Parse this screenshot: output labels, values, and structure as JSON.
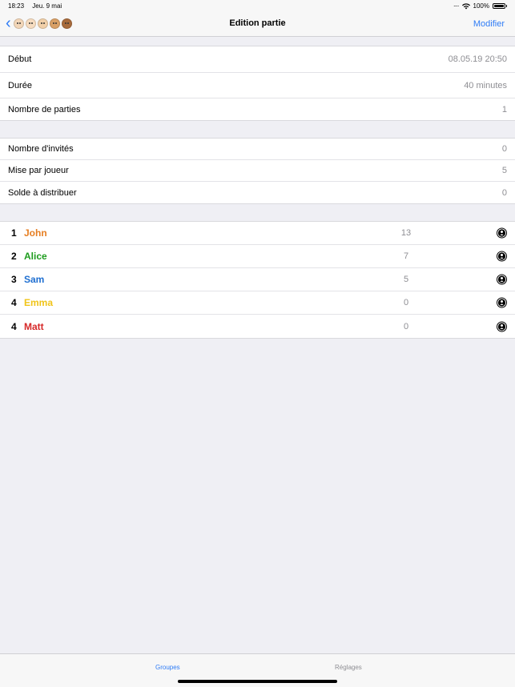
{
  "status_bar": {
    "time": "18:23",
    "date": "Jeu. 9 mai",
    "battery": "100%"
  },
  "nav": {
    "title": "Edition partie",
    "modify_label": "Modifier",
    "avatars": [
      "#f2d6b8",
      "#f6dcc0",
      "#f0cfa8",
      "#d9a066",
      "#a86b3c"
    ]
  },
  "game_info": {
    "start_label": "Début",
    "start_value": "08.05.19 20:50",
    "duration_label": "Durée",
    "duration_value": "40 minutes",
    "count_label": "Nombre de parties",
    "count_value": "1"
  },
  "stakes": {
    "guests_label": "Nombre d'invités",
    "guests_value": "0",
    "bet_label": "Mise par joueur",
    "bet_value": "5",
    "balance_label": "Solde à distribuer",
    "balance_value": "0"
  },
  "players": [
    {
      "rank": "1",
      "name": "John",
      "score": "13",
      "color": "#e67e22"
    },
    {
      "rank": "2",
      "name": "Alice",
      "score": "7",
      "color": "#1e9c1e"
    },
    {
      "rank": "3",
      "name": "Sam",
      "score": "5",
      "color": "#1f6fd1"
    },
    {
      "rank": "4",
      "name": "Emma",
      "score": "0",
      "color": "#f0c419"
    },
    {
      "rank": "4",
      "name": "Matt",
      "score": "0",
      "color": "#d62828"
    }
  ],
  "tabs": {
    "groups": "Groupes",
    "settings": "Réglages"
  },
  "colors": {
    "accent": "#2f7cf6",
    "background": "#efeff4",
    "secondary_text": "#8e8e93"
  }
}
